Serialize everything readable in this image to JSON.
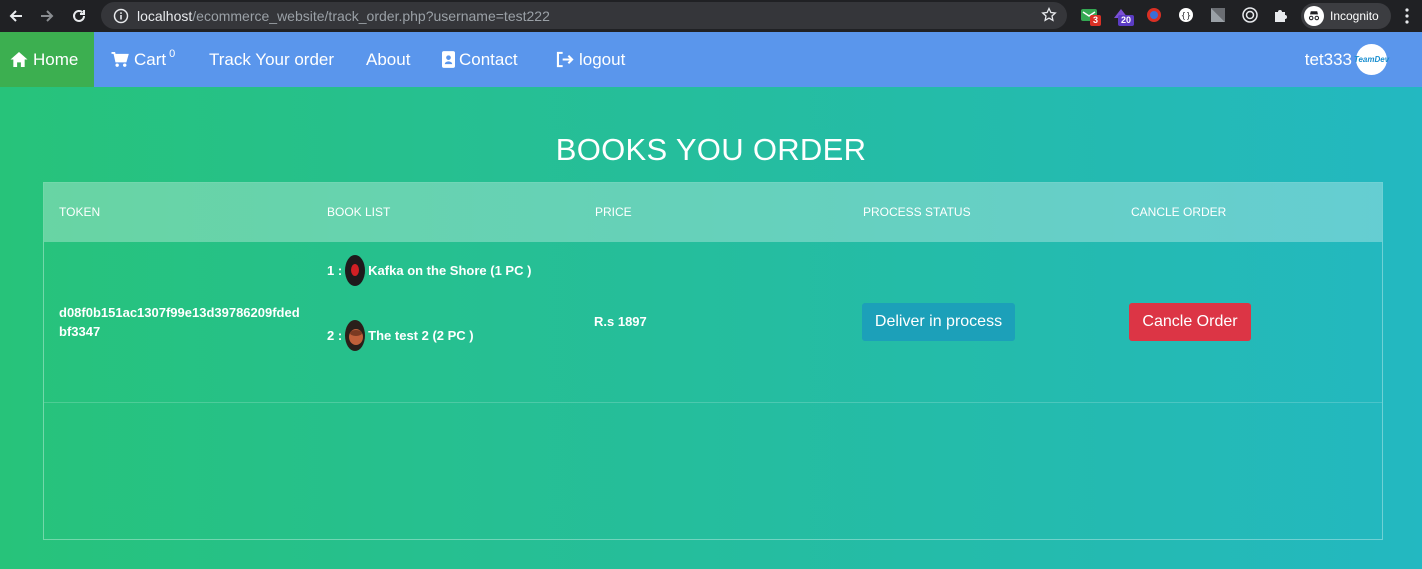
{
  "browser": {
    "url_host": "localhost",
    "url_path": "/ecommerce_website/track_order.php?username=test222",
    "extensions": [
      {
        "icon": "mail-extension-icon",
        "badge": "3",
        "badge_color": "#d93025"
      },
      {
        "icon": "hat-extension-icon",
        "badge": "20",
        "badge_color": "#5b3cc4"
      }
    ],
    "incognito_label": "Incognito"
  },
  "navbar": {
    "home": "Home",
    "cart": "Cart",
    "cart_count": "0",
    "track": "Track Your order",
    "about": "About",
    "contact": "Contact",
    "logout": "logout",
    "username": "tet333",
    "avatar_text": "TeamDev"
  },
  "page": {
    "title": "BOOKS YOU ORDER"
  },
  "table": {
    "headers": [
      "TOKEN",
      "BOOK LIST",
      "PRICE",
      "PROCESS STATUS",
      "CANCLE ORDER"
    ],
    "rows": [
      {
        "token_line1": "d08f0b151ac1307f99e13d39786209fded",
        "token_line2": "bf3347",
        "books": [
          {
            "index": "1 :",
            "title": "Kafka on the Shore (1 PC )"
          },
          {
            "index": "2 :",
            "title": "The test 2 (2 PC )"
          }
        ],
        "price": "R.s 1897",
        "status": "Deliver in process",
        "cancel": "Cancle Order"
      }
    ]
  },
  "colors": {
    "navbar": "#5a96ec",
    "home_active": "#3caf50",
    "deliver_button": "#1ca0b9",
    "cancel_button": "#dc3545"
  }
}
